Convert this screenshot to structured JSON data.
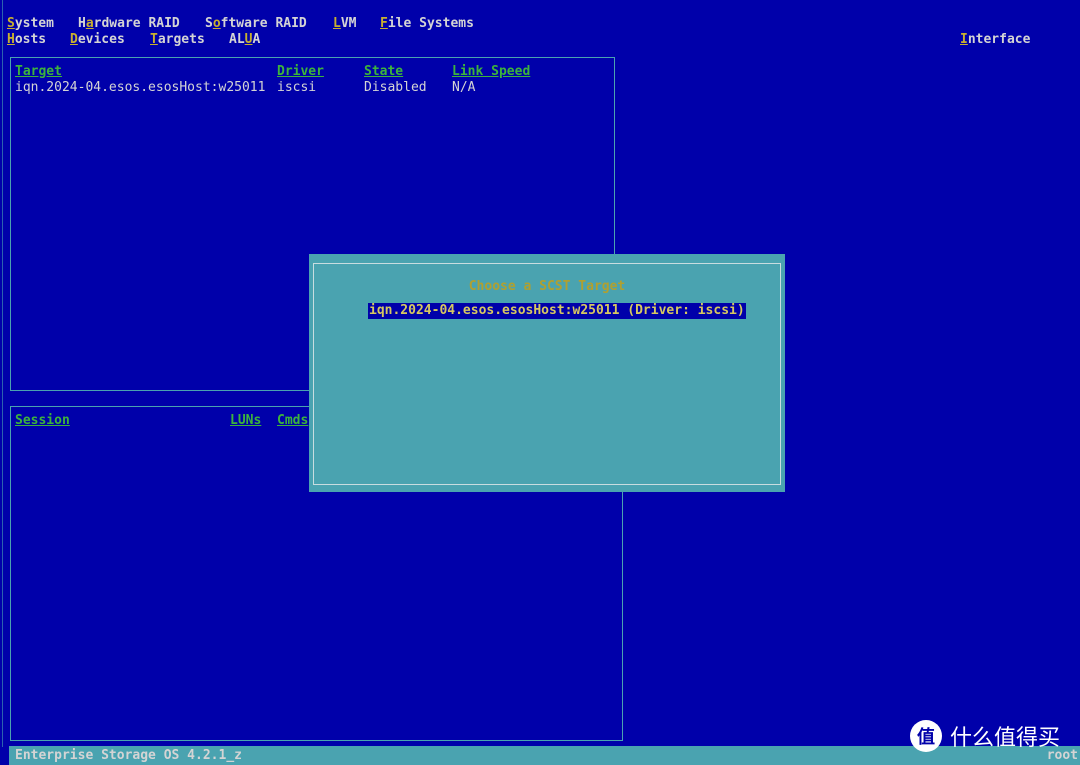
{
  "menu": {
    "row1": [
      {
        "hk_pre": "",
        "hk": "S",
        "rest": "ystem"
      },
      {
        "hk_pre": "H",
        "hk": "a",
        "rest": "rdware RAID"
      },
      {
        "hk_pre": "S",
        "hk": "o",
        "rest": "ftware RAID"
      },
      {
        "hk_pre": "",
        "hk": "L",
        "rest": "VM"
      },
      {
        "hk_pre": "",
        "hk": "F",
        "rest": "ile Systems"
      }
    ],
    "row2": [
      {
        "hk_pre": "",
        "hk": "H",
        "rest": "osts"
      },
      {
        "hk_pre": "",
        "hk": "D",
        "rest": "evices"
      },
      {
        "hk_pre": "",
        "hk": "T",
        "rest": "argets"
      },
      {
        "hk_pre": "AL",
        "hk": "U",
        "rest": "A"
      }
    ],
    "interface": {
      "hk": "I",
      "rest": "nterface"
    }
  },
  "targets_table": {
    "headers": [
      "Target",
      "Driver",
      "State",
      "Link Speed"
    ],
    "rows": [
      [
        "iqn.2024-04.esos.esosHost:w25011",
        "iscsi",
        "Disabled",
        "N/A"
      ]
    ]
  },
  "sessions_table": {
    "headers": [
      "Session",
      "LUNs",
      "Cmds"
    ]
  },
  "dialog": {
    "title": "Choose a SCST Target",
    "items": [
      "iqn.2024-04.esos.esosHost:w25011 (Driver: iscsi)"
    ]
  },
  "status_bar": {
    "left": "Enterprise Storage OS 4.2.1_z",
    "right": "root"
  },
  "watermark": {
    "logo": "值",
    "text": "什么值得买"
  },
  "colors": {
    "background": "#0000aa",
    "dialog": "#4aa3b0",
    "header": "#3cb43c",
    "hotkey": "#c8b030"
  }
}
